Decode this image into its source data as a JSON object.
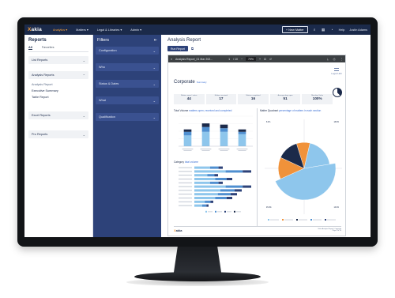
{
  "nav": {
    "logo_prefix": "X",
    "logo_rest": "akia",
    "items": [
      "Analytics",
      "Matters",
      "Legal & Libraries",
      "Admin"
    ],
    "new_matter": "+ New Matter",
    "help": "Help",
    "user": "Justin Adams"
  },
  "reports": {
    "title": "Reports",
    "tabs": [
      "All",
      "Favorites"
    ],
    "sections": {
      "list": "List Reports",
      "analysis": "Analysis Reports",
      "excel": "Excel Reports",
      "pro": "Pro Reports"
    },
    "analysis_items": [
      "Analysis Report",
      "Executive Summary",
      "Table Report"
    ]
  },
  "filters": {
    "title": "Filters",
    "items": [
      "Configuration",
      "Who",
      "Status & Dates",
      "What",
      "Qualification"
    ]
  },
  "main": {
    "title": "Analysis Report",
    "run_button": "Run Report"
  },
  "pdf": {
    "filename": "Analysis Report_01 Mar 202...",
    "page": "1",
    "pages": "/ 10",
    "zoom": "79%"
  },
  "report": {
    "title": "Corporate",
    "title_sub": "Summary",
    "brand": "Legal Hub",
    "stats": [
      {
        "label": "Matters open / active",
        "value": "44"
      },
      {
        "label": "Matters received",
        "value": "17"
      },
      {
        "label": "Matters completed",
        "value": "16"
      },
      {
        "label": "Average days open",
        "value": "51"
      },
      {
        "label": "Matching Value",
        "value": "100%"
      }
    ],
    "chart1_title": "Total Volume",
    "chart1_sub": "matters open, received and completed",
    "chart2_title": "Matter Quadrant",
    "chart2_sub": "percentage of matters in each section",
    "chart3_title": "Category",
    "chart3_sub": "total volume",
    "footer_logo_prefix": "X",
    "footer_logo_rest": "akia",
    "footer_text_1": "Xakia Analysis Report | Copyright",
    "footer_text_2": "Page 1 of 10"
  },
  "colors": {
    "navy": "#1b2a4a",
    "filter_blue": "#2d4279",
    "light_blue": "#8ec6ec",
    "orange": "#f0923a",
    "accent_orange": "#f5a13b"
  },
  "chart_data": [
    {
      "type": "bar",
      "title": "Total Volume",
      "categories": [
        "",
        "",
        "",
        ""
      ],
      "series": [
        {
          "values": [
            9,
            12,
            12,
            10
          ]
        },
        {
          "values": [
            3,
            4,
            3,
            2
          ]
        },
        {
          "values": [
            2,
            3,
            3,
            2
          ]
        }
      ],
      "ylim": [
        0,
        25
      ]
    },
    {
      "type": "bar",
      "title": "Category",
      "orientation": "horizontal",
      "categories": [
        "",
        "",
        "",
        "",
        "",
        "",
        "",
        "",
        "",
        "",
        ""
      ],
      "values": [
        6,
        12,
        5,
        8,
        6,
        12,
        10,
        9,
        8,
        4,
        3
      ]
    },
    {
      "type": "pie",
      "title": "Matter Quadrant",
      "slices": [
        {
          "label": "",
          "value": 8.4,
          "color": "#f0923a"
        },
        {
          "label": "",
          "value": 18.8,
          "color": "#8ec6ec"
        },
        {
          "label": "",
          "value": 45.9,
          "color": "#8ec6ec"
        },
        {
          "label": "",
          "value": 13.6,
          "color": "#f0923a"
        },
        {
          "label": "",
          "value": 13.3,
          "color": "#1b2a4a"
        }
      ],
      "labels": [
        "8.4%",
        "18.8%",
        "45.9%",
        "13.6%"
      ]
    }
  ]
}
